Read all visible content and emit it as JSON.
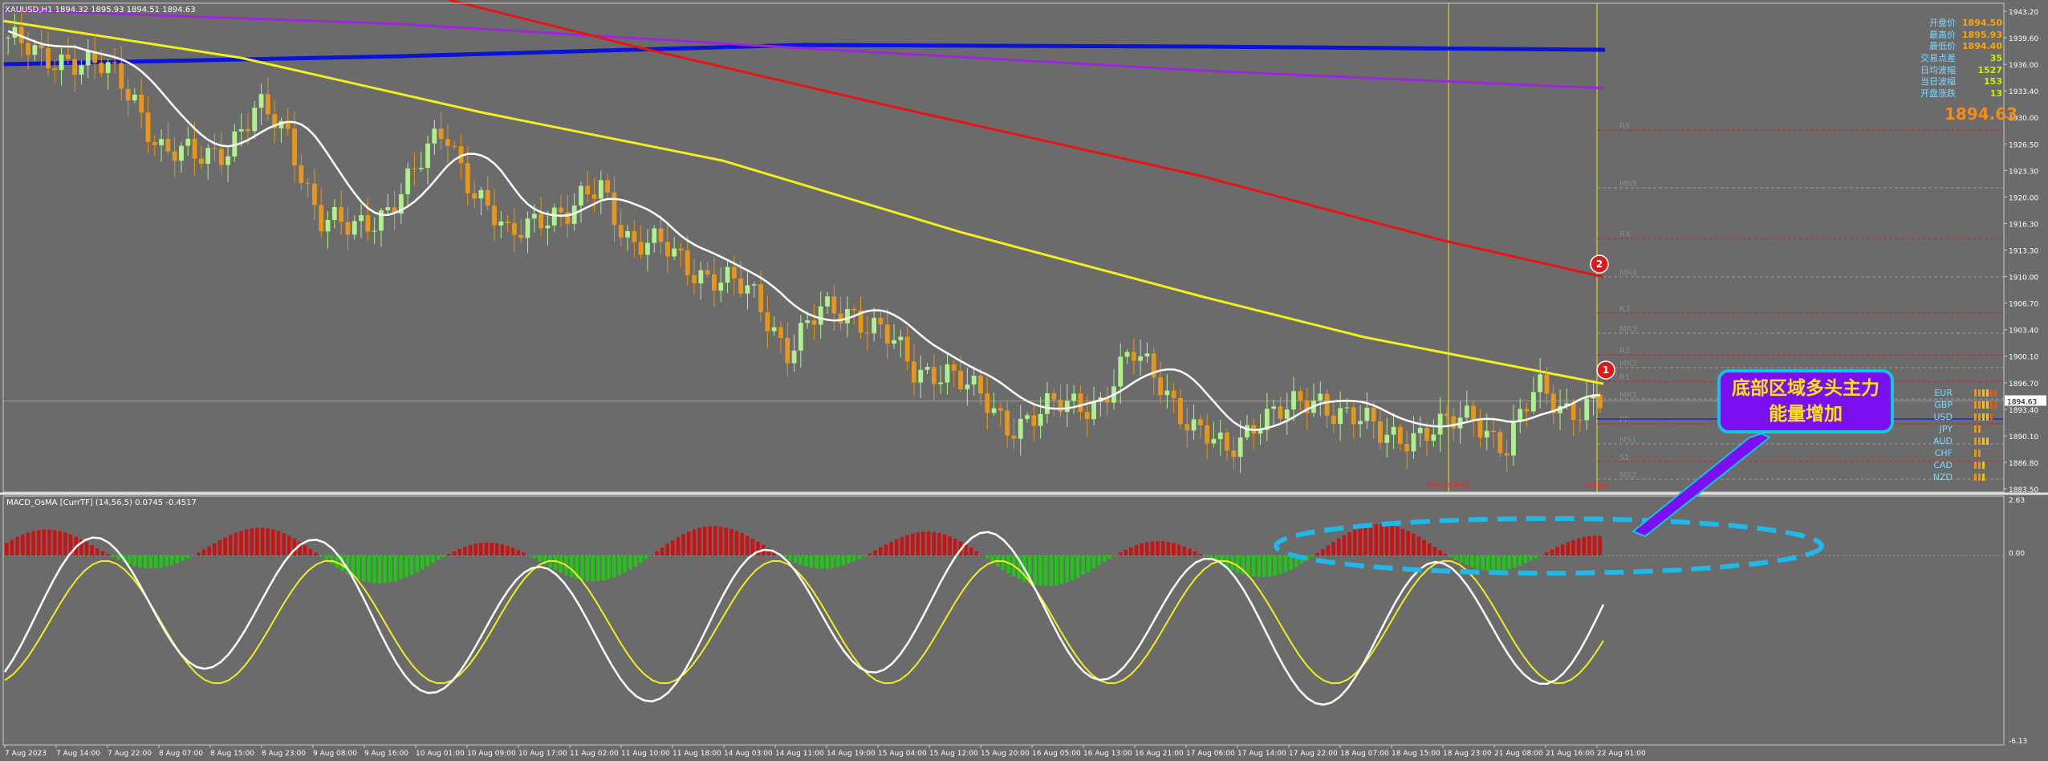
{
  "header": {
    "symbol_info": "XAUUSD,H1  1894.32 1895.93 1894.51 1894.63"
  },
  "info_panel": [
    {
      "label": "开盘价",
      "value": "1894.50"
    },
    {
      "label": "最高价",
      "value": "1895.93"
    },
    {
      "label": "最低价",
      "value": "1894.40"
    },
    {
      "label": "交易点差",
      "value": "35"
    },
    {
      "label": "日均波幅",
      "value": "1527"
    },
    {
      "label": "当日波幅",
      "value": "153"
    },
    {
      "label": "开盘涨跌",
      "value": "13"
    }
  ],
  "current_price_big": "1894.63",
  "price_axis": [
    "1943.20",
    "1939.60",
    "1936.00",
    "1933.40",
    "1930.00",
    "1926.50",
    "1923.30",
    "1920.00",
    "1916.30",
    "1913.30",
    "1910.00",
    "1906.70",
    "1903.40",
    "1900.10",
    "1896.70",
    "1893.40",
    "1890.10",
    "1886.80",
    "1883.50"
  ],
  "price_tag": "1894.63",
  "pivot_labels": [
    "R5",
    "MR5",
    "R4",
    "MR4",
    "R3",
    "MR3",
    "R2",
    "MR2",
    "R1",
    "MR1",
    "PP",
    "MS1",
    "S1",
    "MS2"
  ],
  "currency_strength": [
    "EUR",
    "GBP",
    "USD",
    "JPY",
    "AUD",
    "CHF",
    "CAD",
    "NZD"
  ],
  "markers": {
    "m1": "1",
    "m2": "2"
  },
  "vlabels": {
    "yesterday": "Yesterday",
    "today": "Today"
  },
  "indicator": {
    "title": "MACD_OsMA [CurrTF] (14,56,5) 0.0745 -0.4517",
    "axis": [
      "2.63",
      "0.00",
      "-6.13"
    ]
  },
  "time_axis": [
    "7 Aug 2023",
    "7 Aug 14:00",
    "7 Aug 22:00",
    "8 Aug 07:00",
    "8 Aug 15:00",
    "8 Aug 23:00",
    "9 Aug 08:00",
    "9 Aug 16:00",
    "10 Aug 01:00",
    "10 Aug 09:00",
    "10 Aug 17:00",
    "11 Aug 02:00",
    "11 Aug 10:00",
    "11 Aug 18:00",
    "14 Aug 03:00",
    "14 Aug 11:00",
    "14 Aug 19:00",
    "15 Aug 04:00",
    "15 Aug 12:00",
    "15 Aug 20:00",
    "16 Aug 05:00",
    "16 Aug 13:00",
    "16 Aug 21:00",
    "17 Aug 06:00",
    "17 Aug 14:00",
    "17 Aug 22:00",
    "18 Aug 07:00",
    "18 Aug 15:00",
    "18 Aug 23:00",
    "21 Aug 08:00",
    "21 Aug 16:00",
    "22 Aug 01:00"
  ],
  "callout": {
    "line1": "底部区域多头主力",
    "line2": "能量增加"
  },
  "colors": {
    "bg": "#6b6b6b",
    "bull": "#aef28c",
    "bear": "#e8961a",
    "ma_white": "#ffffff",
    "ma_yellow": "#f2ee22",
    "ma_red": "#e81414",
    "ma_purple": "#9b27d8",
    "ma_blue": "#0a14d8",
    "hist_green": "#25c21c",
    "hist_red": "#c81414",
    "callout_bg": "#7a0ff0",
    "callout_border": "#12c6de",
    "callout_text": "#ffe414"
  },
  "chart_data": {
    "type": "candlestick",
    "symbol": "XAUUSD",
    "timeframe": "H1",
    "ylim": [
      1883.5,
      1943.2
    ],
    "ohlc_current": {
      "open": 1894.32,
      "high": 1895.93,
      "low": 1894.51,
      "close": 1894.63
    },
    "price_path": [
      1939,
      1936,
      1937,
      1935,
      1932,
      1925,
      1924,
      1926,
      1930,
      1927,
      1917,
      1915,
      1918,
      1922,
      1928,
      1920,
      1914,
      1918,
      1917,
      1921,
      1914,
      1913,
      1911,
      1909,
      1907,
      1901,
      1905,
      1906,
      1903,
      1898,
      1899,
      1895,
      1892,
      1893,
      1894,
      1895,
      1900,
      1897,
      1891,
      1888,
      1893,
      1893,
      1895,
      1893,
      1890,
      1891,
      1891,
      1893,
      1889,
      1896,
      1894,
      1894
    ]
  }
}
